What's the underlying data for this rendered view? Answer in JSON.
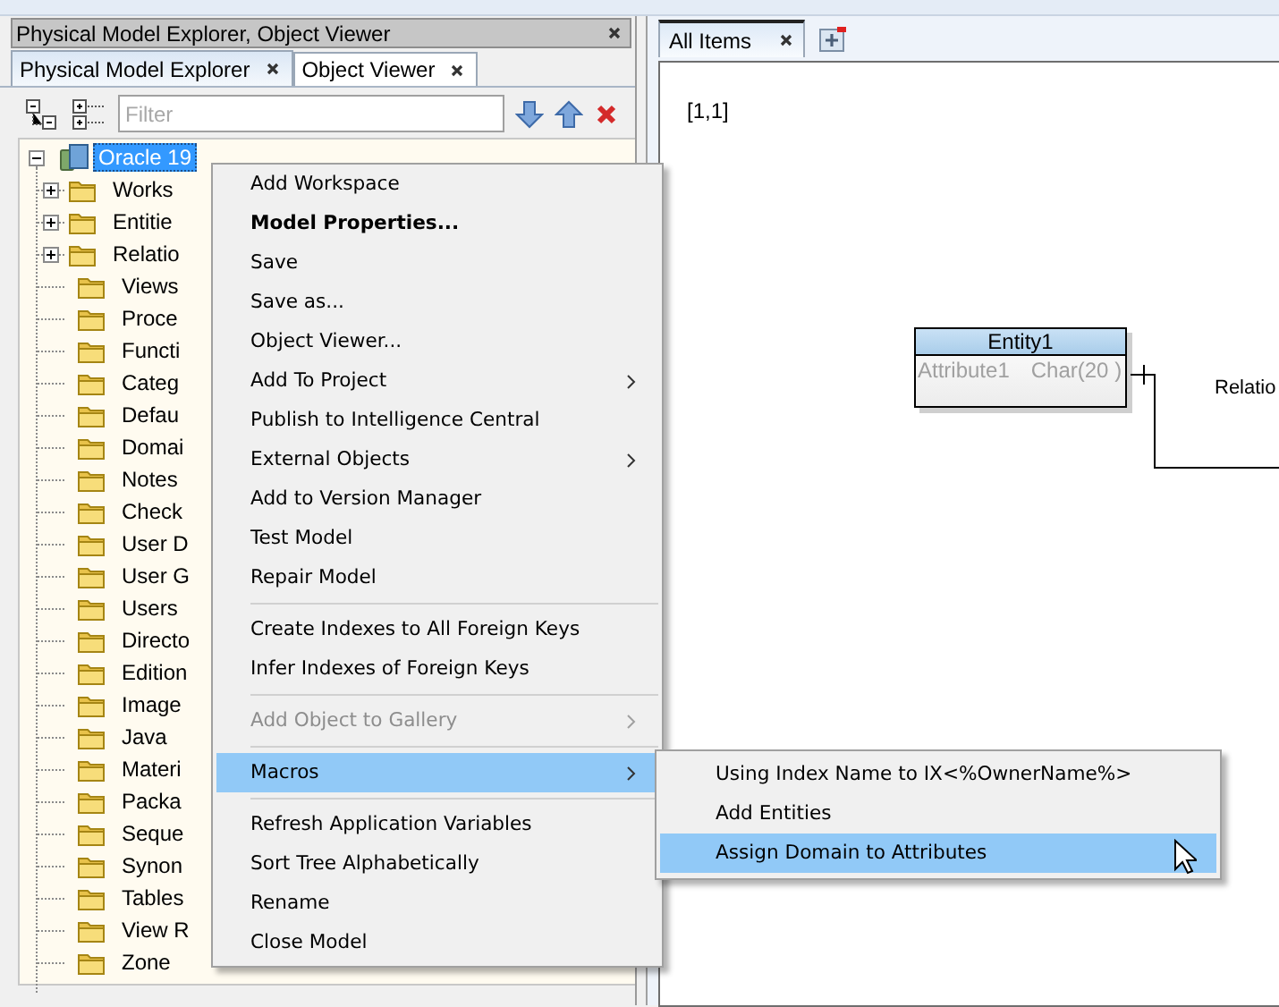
{
  "left_panel": {
    "title": "Physical Model Explorer, Object Viewer",
    "tabs": [
      {
        "label": "Physical Model Explorer",
        "selected": true
      },
      {
        "label": "Object Viewer",
        "selected": false
      }
    ],
    "filter": {
      "placeholder": "Filter"
    },
    "tree": {
      "label": "Oracle 19",
      "kind": "model",
      "selected": true,
      "expanded": true,
      "children": [
        {
          "label": "Works",
          "kind": "group",
          "selected": false,
          "expanded": false
        },
        {
          "label": "Entitie",
          "kind": "group",
          "selected": false,
          "expanded": false
        },
        {
          "label": "Relatio",
          "kind": "group",
          "selected": false,
          "expanded": false
        },
        {
          "label": "Views",
          "kind": "folder",
          "selected": false
        },
        {
          "label": "Proce",
          "kind": "folder",
          "selected": false
        },
        {
          "label": "Functi",
          "kind": "folder",
          "selected": false
        },
        {
          "label": "Categ",
          "kind": "folder",
          "selected": false
        },
        {
          "label": "Defau",
          "kind": "folder",
          "selected": false
        },
        {
          "label": "Domai",
          "kind": "folder",
          "selected": false
        },
        {
          "label": "Notes",
          "kind": "folder",
          "selected": false
        },
        {
          "label": "Check",
          "kind": "folder",
          "selected": false
        },
        {
          "label": "User D",
          "kind": "folder",
          "selected": false
        },
        {
          "label": "User G",
          "kind": "folder",
          "selected": false
        },
        {
          "label": "Users",
          "kind": "folder",
          "selected": false
        },
        {
          "label": "Directo",
          "kind": "folder",
          "selected": false
        },
        {
          "label": "Edition",
          "kind": "folder",
          "selected": false
        },
        {
          "label": "Image",
          "kind": "folder",
          "selected": false
        },
        {
          "label": "Java",
          "kind": "folder",
          "selected": false
        },
        {
          "label": "Materi",
          "kind": "folder",
          "selected": false
        },
        {
          "label": "Packa",
          "kind": "folder",
          "selected": false
        },
        {
          "label": "Seque",
          "kind": "folder",
          "selected": false
        },
        {
          "label": "Synon",
          "kind": "folder",
          "selected": false
        },
        {
          "label": "Tables",
          "kind": "folder",
          "selected": false
        },
        {
          "label": "View R",
          "kind": "folder",
          "selected": false
        },
        {
          "label": "Zone",
          "kind": "folder",
          "selected": false
        }
      ]
    }
  },
  "diagram": {
    "tabs": [
      {
        "label": "All Items",
        "selected": true
      }
    ],
    "page_label": "[1,1]",
    "entity": {
      "name": "Entity1",
      "attributes": [
        {
          "name": "Attribute1",
          "type": "Char(20 )"
        }
      ]
    },
    "relation_label": "Relatio"
  },
  "context_menu": {
    "items": [
      {
        "kind": "item",
        "label": "Add Workspace",
        "default": false,
        "disabled": false,
        "submenu": false,
        "selected": false
      },
      {
        "kind": "item",
        "label": "Model Properties...",
        "default": true,
        "disabled": false,
        "submenu": false,
        "selected": false
      },
      {
        "kind": "item",
        "label": "Save",
        "default": false,
        "disabled": false,
        "submenu": false,
        "selected": false
      },
      {
        "kind": "item",
        "label": "Save as...",
        "default": false,
        "disabled": false,
        "submenu": false,
        "selected": false
      },
      {
        "kind": "item",
        "label": "Object Viewer...",
        "default": false,
        "disabled": false,
        "submenu": false,
        "selected": false
      },
      {
        "kind": "item",
        "label": "Add To Project",
        "default": false,
        "disabled": false,
        "submenu": true,
        "selected": false
      },
      {
        "kind": "item",
        "label": "Publish to Intelligence Central",
        "default": false,
        "disabled": false,
        "submenu": false,
        "selected": false
      },
      {
        "kind": "item",
        "label": "External Objects",
        "default": false,
        "disabled": false,
        "submenu": true,
        "selected": false
      },
      {
        "kind": "item",
        "label": "Add to Version Manager",
        "default": false,
        "disabled": false,
        "submenu": false,
        "selected": false
      },
      {
        "kind": "item",
        "label": "Test Model",
        "default": false,
        "disabled": false,
        "submenu": false,
        "selected": false
      },
      {
        "kind": "item",
        "label": "Repair Model",
        "default": false,
        "disabled": false,
        "submenu": false,
        "selected": false
      },
      {
        "kind": "separator"
      },
      {
        "kind": "item",
        "label": "Create Indexes to All Foreign Keys",
        "default": false,
        "disabled": false,
        "submenu": false,
        "selected": false
      },
      {
        "kind": "item",
        "label": "Infer Indexes of Foreign Keys",
        "default": false,
        "disabled": false,
        "submenu": false,
        "selected": false
      },
      {
        "kind": "separator"
      },
      {
        "kind": "item",
        "label": "Add Object to Gallery",
        "default": false,
        "disabled": true,
        "submenu": true,
        "selected": false
      },
      {
        "kind": "separator"
      },
      {
        "kind": "item",
        "label": "Macros",
        "default": false,
        "disabled": false,
        "submenu": true,
        "selected": true
      },
      {
        "kind": "separator"
      },
      {
        "kind": "item",
        "label": "Refresh Application Variables",
        "default": false,
        "disabled": false,
        "submenu": false,
        "selected": false
      },
      {
        "kind": "item",
        "label": "Sort Tree Alphabetically",
        "default": false,
        "disabled": false,
        "submenu": false,
        "selected": false
      },
      {
        "kind": "item",
        "label": "Rename",
        "default": false,
        "disabled": false,
        "submenu": false,
        "selected": false
      },
      {
        "kind": "item",
        "label": "Close Model",
        "default": false,
        "disabled": false,
        "submenu": false,
        "selected": false
      }
    ]
  },
  "submenu": {
    "items": [
      {
        "label": "Using Index Name to IX<%OwnerName%>",
        "selected": false
      },
      {
        "label": "Add Entities",
        "selected": false
      },
      {
        "label": "Assign Domain to Attributes",
        "selected": true
      }
    ]
  }
}
